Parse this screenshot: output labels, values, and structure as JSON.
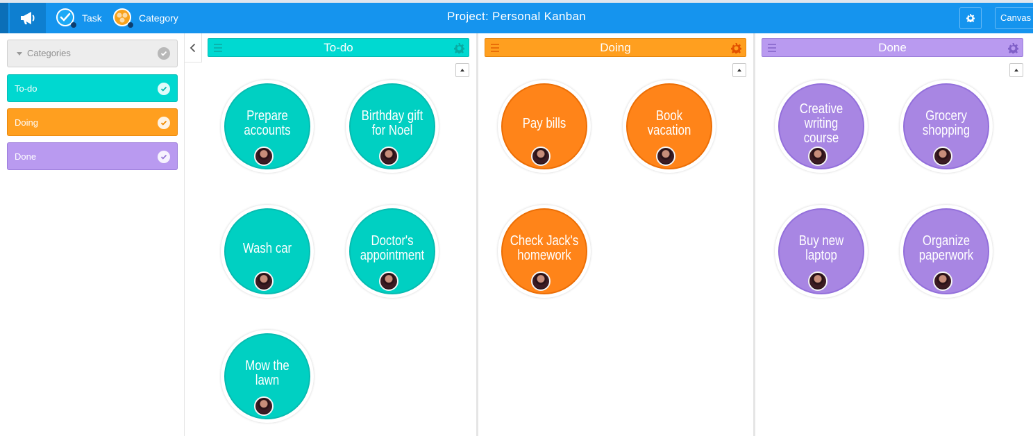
{
  "header": {
    "title": "Project: Personal Kanban",
    "task_label": "Task",
    "category_label": "Category",
    "canvas_label": "Canvas"
  },
  "sidebar": {
    "categories_label": "Categories",
    "items": [
      {
        "label": "To-do",
        "color": "#00d8d0"
      },
      {
        "label": "Doing",
        "color": "#ff9f1f"
      },
      {
        "label": "Done",
        "color": "#b99af0"
      }
    ]
  },
  "columns": [
    {
      "title": "To-do",
      "color": "#00d0c2",
      "tasks": [
        "Prepare accounts",
        "Birthday gift for Noel",
        "Wash car",
        "Doctor's appointment",
        "Mow the lawn"
      ]
    },
    {
      "title": "Doing",
      "color": "#ff8419",
      "tasks": [
        "Pay bills",
        "Book vacation",
        "Check Jack's homework"
      ]
    },
    {
      "title": "Done",
      "color": "#a886e3",
      "tasks": [
        "Creative writing course",
        "Grocery shopping",
        "Buy new laptop",
        "Organize paperwork"
      ]
    }
  ],
  "icons": [
    "megaphone-icon",
    "task-check-icon",
    "category-icon",
    "gear-icon",
    "chevron-left-icon",
    "menu-icon",
    "sort-up-icon",
    "avatar-icon"
  ]
}
